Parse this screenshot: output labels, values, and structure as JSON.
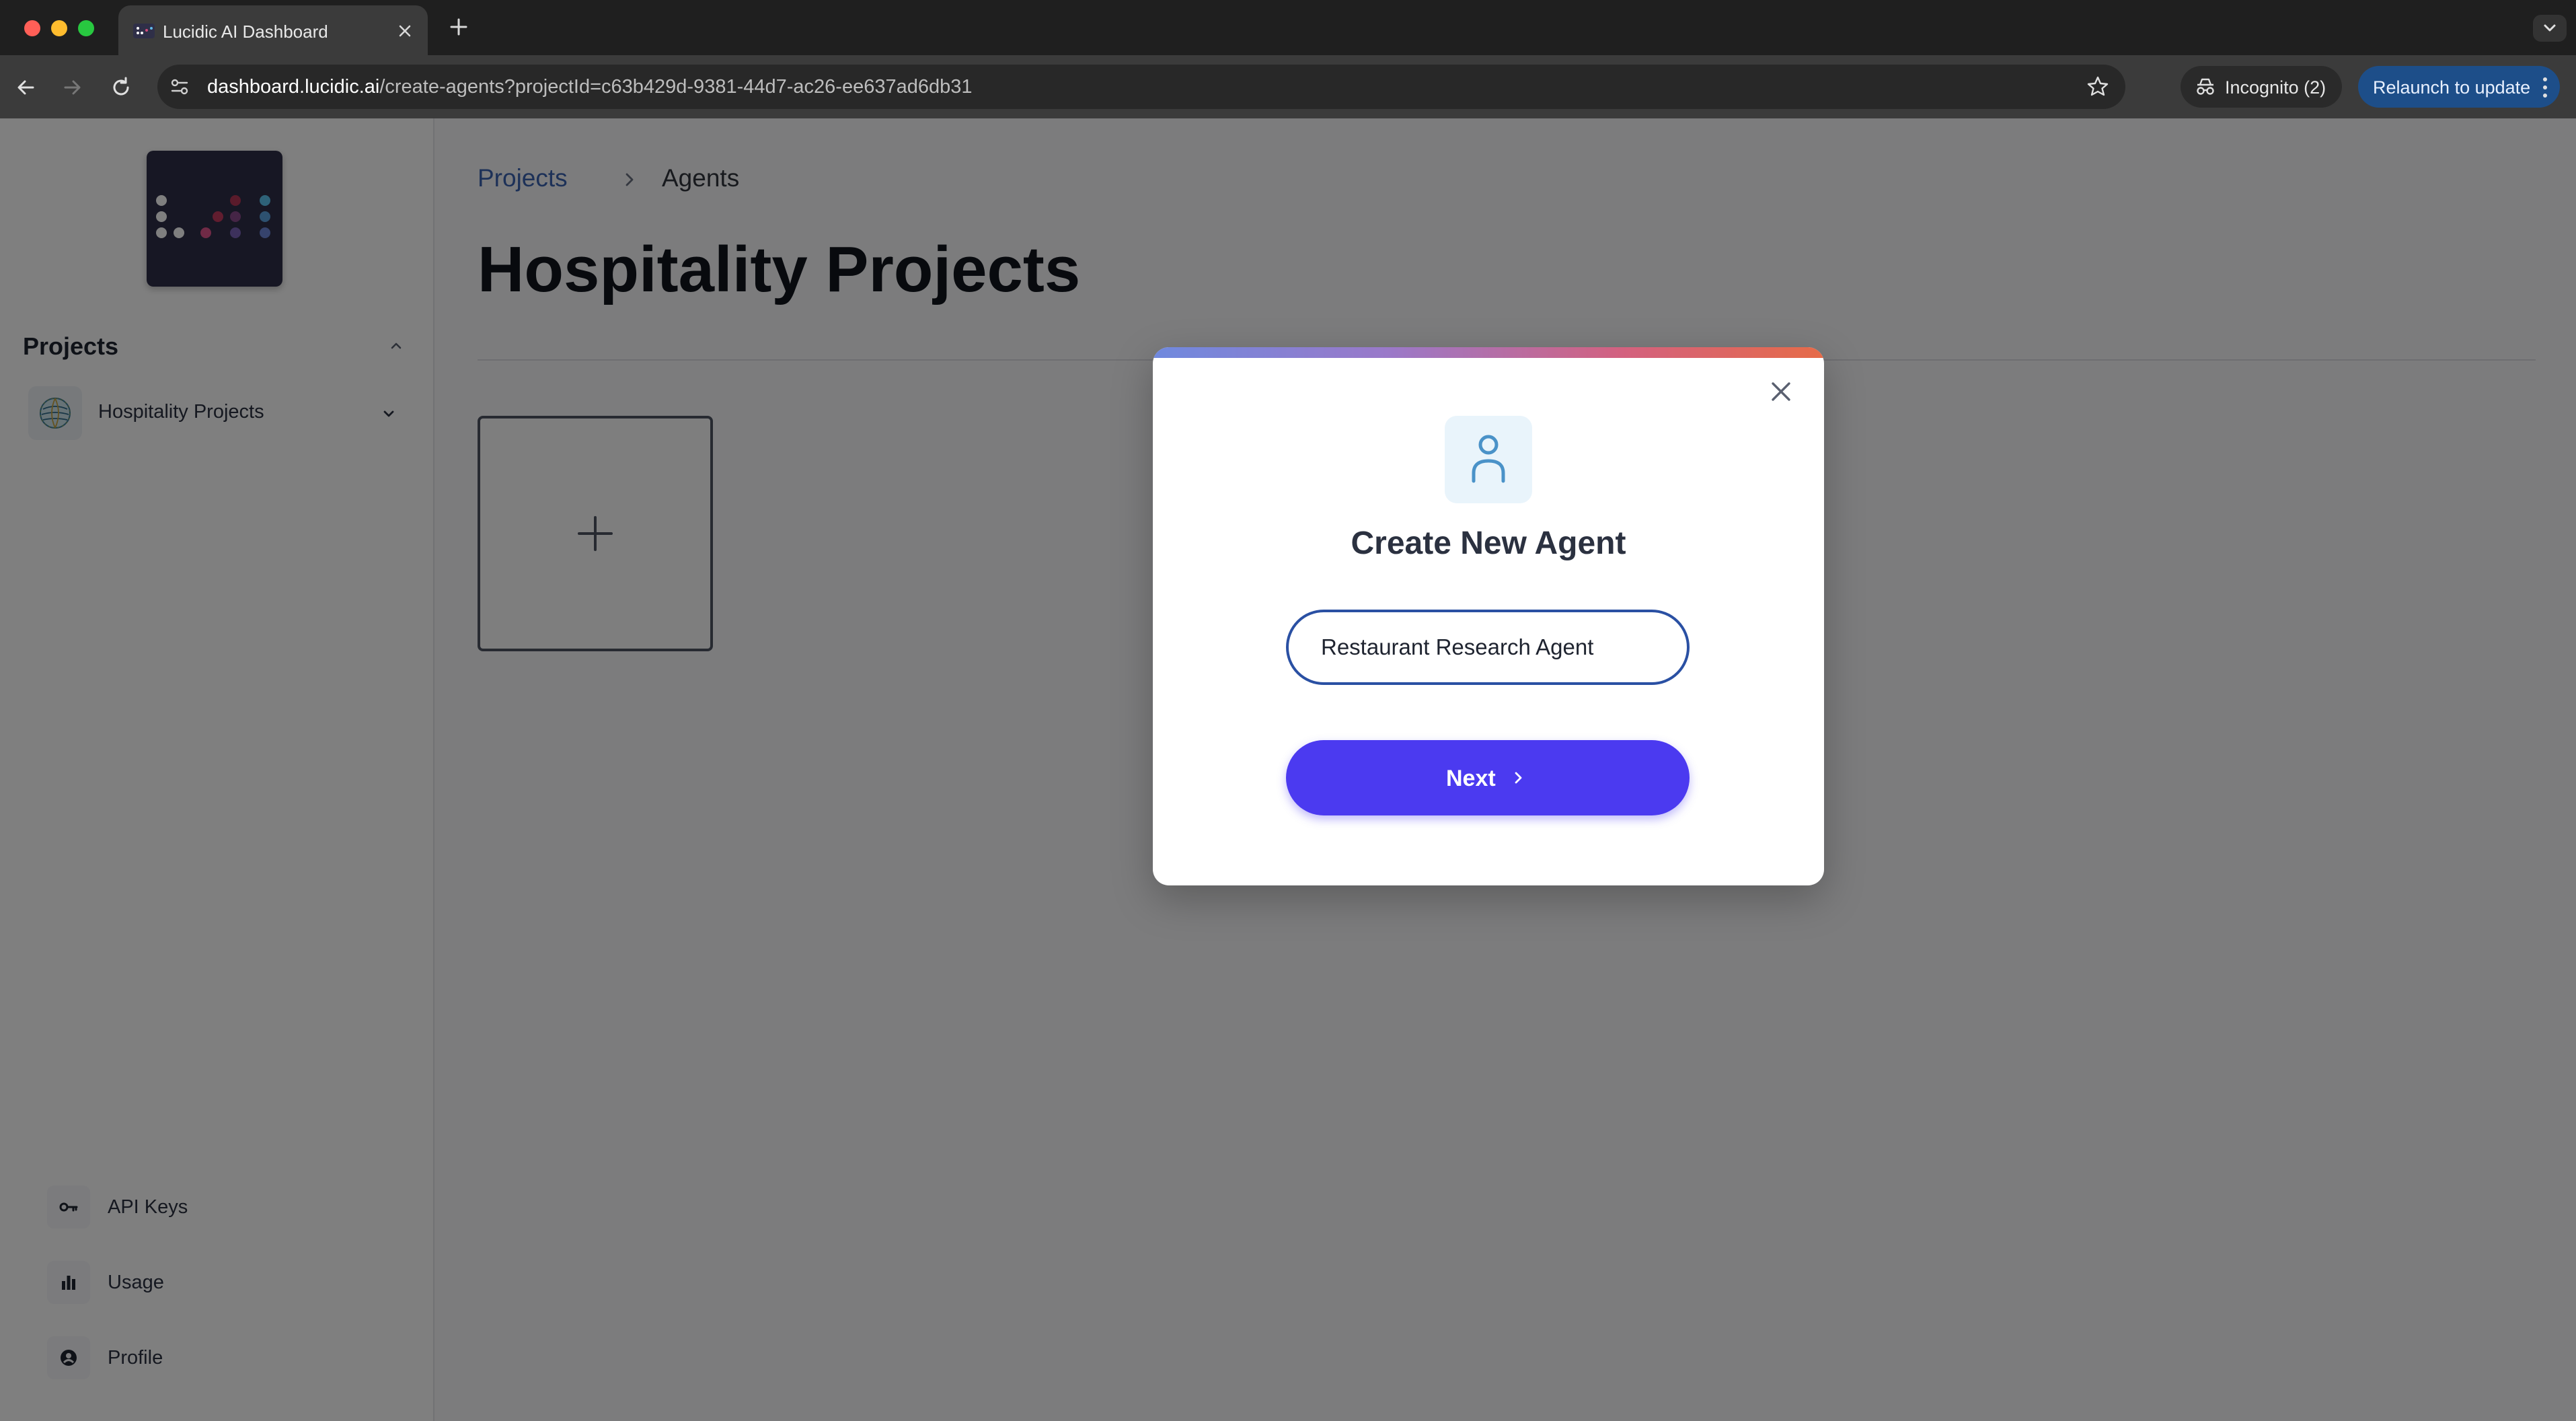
{
  "browser": {
    "tab_title": "Lucidic AI Dashboard",
    "url_host": "dashboard.lucidic.ai",
    "url_path": "/create-agents?projectId=c63b429d-9381-44d7-ac26-ee637ad6db31",
    "incognito_label": "Incognito (2)",
    "relaunch_label": "Relaunch to update"
  },
  "sidebar": {
    "projects_heading": "Projects",
    "project_name": "Hospitality Projects",
    "links": [
      {
        "label": "API Keys",
        "icon": "key-icon"
      },
      {
        "label": "Usage",
        "icon": "bar-chart-icon"
      },
      {
        "label": "Profile",
        "icon": "user-circle-icon"
      }
    ]
  },
  "main": {
    "breadcrumb": [
      "Projects",
      "Agents"
    ],
    "page_title": "Hospitality Projects"
  },
  "modal": {
    "title": "Create New Agent",
    "input_value": "Restaurant Research Agent",
    "next_label": "Next"
  },
  "colors": {
    "primary_button": "#4b3af0",
    "input_border": "#2a50a3",
    "relaunch_bg": "#1d4e89",
    "sidebar_logo_bg": "#2f2f48"
  }
}
